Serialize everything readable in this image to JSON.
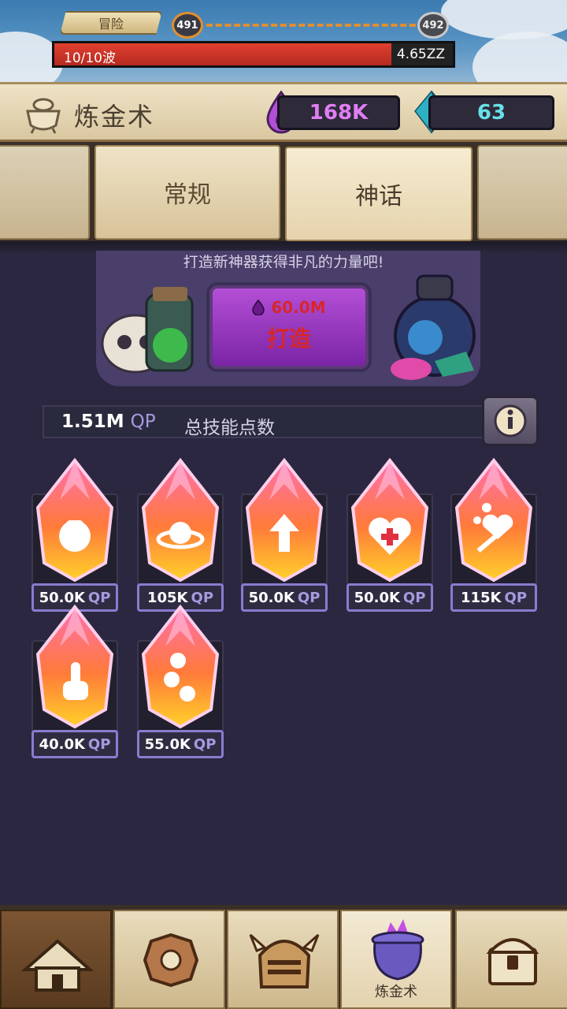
{
  "adventure": {
    "tab_label": "冒险",
    "current_level": "491",
    "next_level": "492",
    "wave_text": "10/10波",
    "wave_damage": "4.65ZZ"
  },
  "header": {
    "title": "炼金术",
    "essence": "168K",
    "gems": "63"
  },
  "tabs": [
    {
      "label": ""
    },
    {
      "label": "常规"
    },
    {
      "label": "神话"
    },
    {
      "label": ""
    }
  ],
  "craft": {
    "hint": "打造新神器获得非凡的力量吧!",
    "cost": "60.0M",
    "button_label": "打造"
  },
  "qp": {
    "value": "1.51M",
    "unit": "QP",
    "label": "总技能点数"
  },
  "artifacts": [
    {
      "cost": "50.0K",
      "unit": "QP",
      "icon": "fist-icon"
    },
    {
      "cost": "105K",
      "unit": "QP",
      "icon": "planet-bomb-icon"
    },
    {
      "cost": "50.0K",
      "unit": "QP",
      "icon": "arrow-up-icon"
    },
    {
      "cost": "50.0K",
      "unit": "QP",
      "icon": "heart-plus-icon"
    },
    {
      "cost": "115K",
      "unit": "QP",
      "icon": "heart-sword-coins-icon"
    },
    {
      "cost": "40.0K",
      "unit": "QP",
      "icon": "pointing-hand-icon"
    },
    {
      "cost": "55.0K",
      "unit": "QP",
      "icon": "coins-icon"
    }
  ],
  "nav": {
    "items": [
      {
        "label": "",
        "icon": "house-icon"
      },
      {
        "label": "",
        "icon": "shield-gear-icon"
      },
      {
        "label": "",
        "icon": "knight-helmet-icon"
      },
      {
        "label": "炼金术",
        "icon": "cauldron-icon"
      },
      {
        "label": "",
        "icon": "treasure-chest-icon"
      }
    ]
  }
}
